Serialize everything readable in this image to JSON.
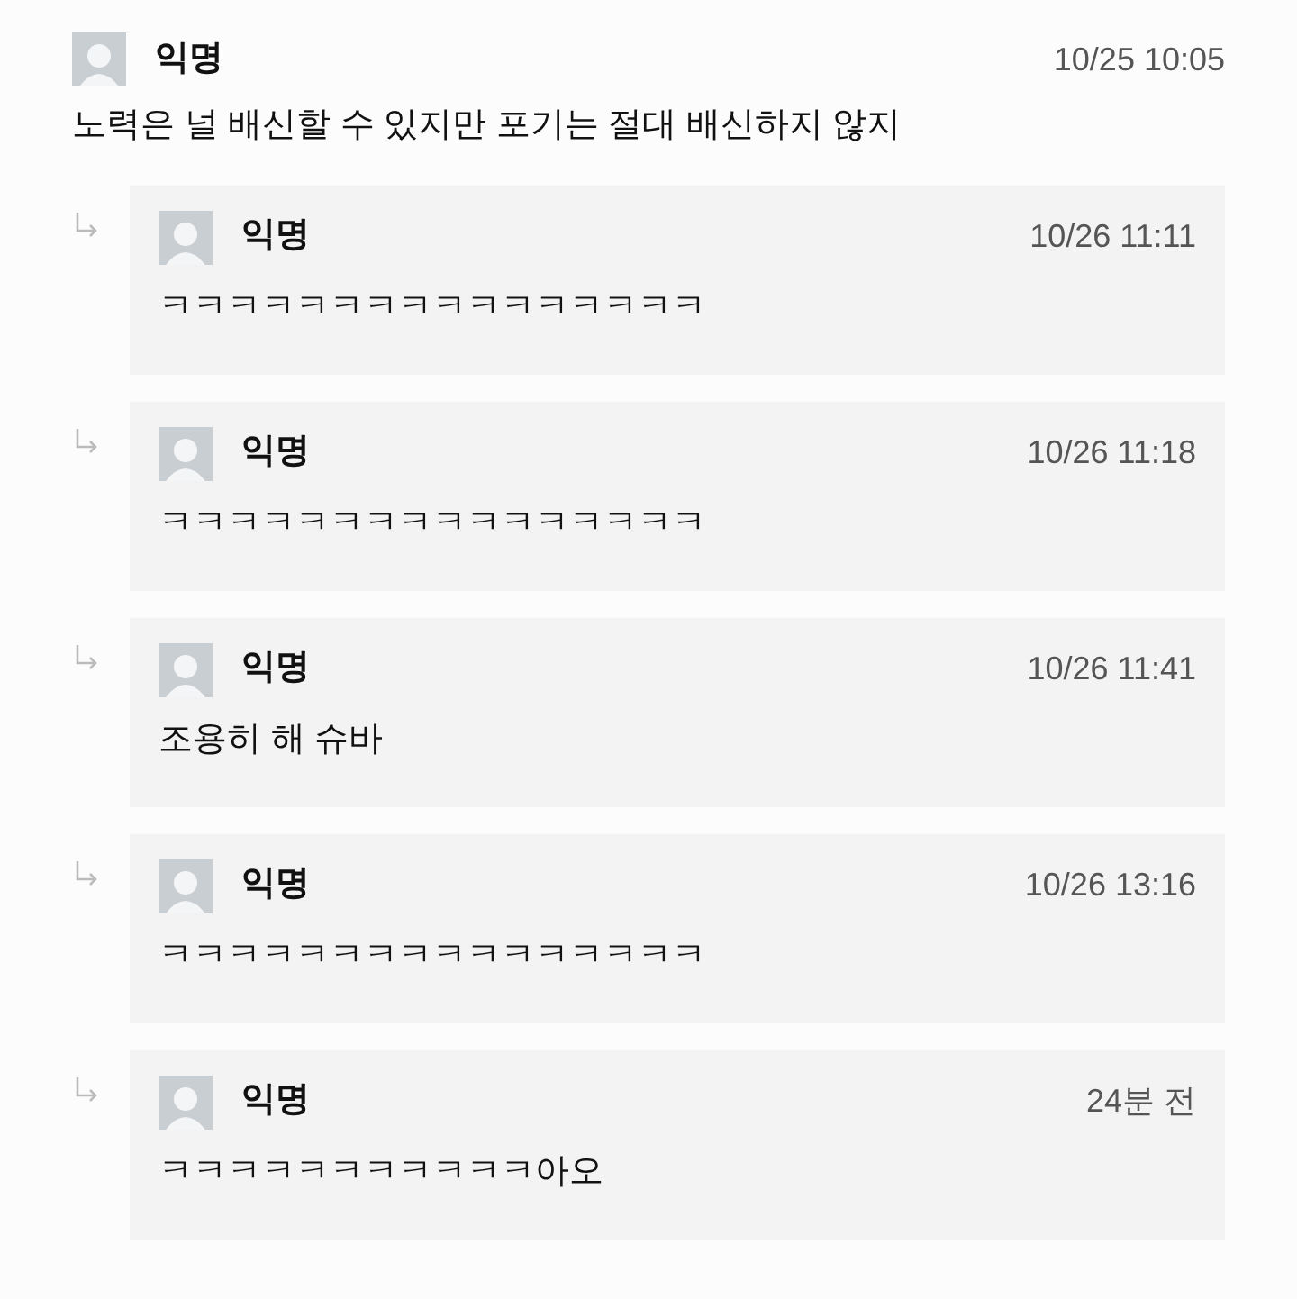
{
  "comment": {
    "author": "익명",
    "time": "10/25 10:05",
    "text": "노력은 널 배신할 수 있지만 포기는 절대 배신하지 않지"
  },
  "replies": [
    {
      "author": "익명",
      "time": "10/26 11:11",
      "text": "ㅋㅋㅋㅋㅋㅋㅋㅋㅋㅋㅋㅋㅋㅋㅋㅋ"
    },
    {
      "author": "익명",
      "time": "10/26 11:18",
      "text": "ㅋㅋㅋㅋㅋㅋㅋㅋㅋㅋㅋㅋㅋㅋㅋㅋ"
    },
    {
      "author": "익명",
      "time": "10/26 11:41",
      "text": "조용히 해 슈바"
    },
    {
      "author": "익명",
      "time": "10/26 13:16",
      "text": "ㅋㅋㅋㅋㅋㅋㅋㅋㅋㅋㅋㅋㅋㅋㅋㅋ"
    },
    {
      "author": "익명",
      "time": "24분 전",
      "text": "ㅋㅋㅋㅋㅋㅋㅋㅋㅋㅋㅋ아오"
    }
  ]
}
